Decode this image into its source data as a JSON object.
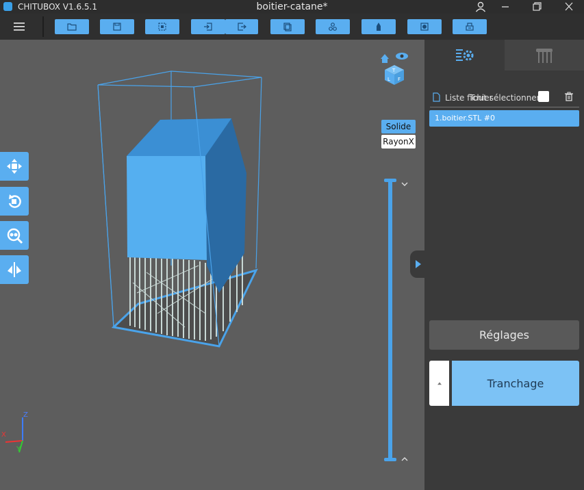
{
  "window": {
    "app_title": "CHITUBOX V1.6.5.1",
    "document_title": "boitier-catane*"
  },
  "toolbar": {
    "buttons": [
      {
        "icon": "open-folder-icon"
      },
      {
        "icon": "save-icon"
      },
      {
        "icon": "select-icon"
      },
      {
        "icon": "import-icon"
      },
      {
        "icon": "export-icon"
      },
      {
        "icon": "copy-icon"
      },
      {
        "icon": "layout-icon"
      },
      {
        "icon": "hollow-icon"
      },
      {
        "icon": "drill-icon"
      },
      {
        "icon": "print-icon"
      }
    ]
  },
  "viewport": {
    "left_tools": [
      "move-icon",
      "rotate-icon",
      "scale-icon",
      "mirror-icon"
    ],
    "view_modes": {
      "solid": "Solide",
      "xray": "RayonX"
    },
    "axes": {
      "x": "X",
      "y": "Y",
      "z": "Z"
    }
  },
  "panel": {
    "tabs": [
      "settings-tab-icon",
      "supports-tab-icon"
    ],
    "file_list_label": "Liste fichier",
    "select_all_label": "Tout sélectionner",
    "files": [
      "1.boitier.STL #0"
    ],
    "settings_button": "Réglages",
    "slice_button": "Tranchage"
  },
  "colors": {
    "accent": "#5aaef0",
    "model": "#4a9fe0",
    "panel": "#3a3a3a"
  }
}
